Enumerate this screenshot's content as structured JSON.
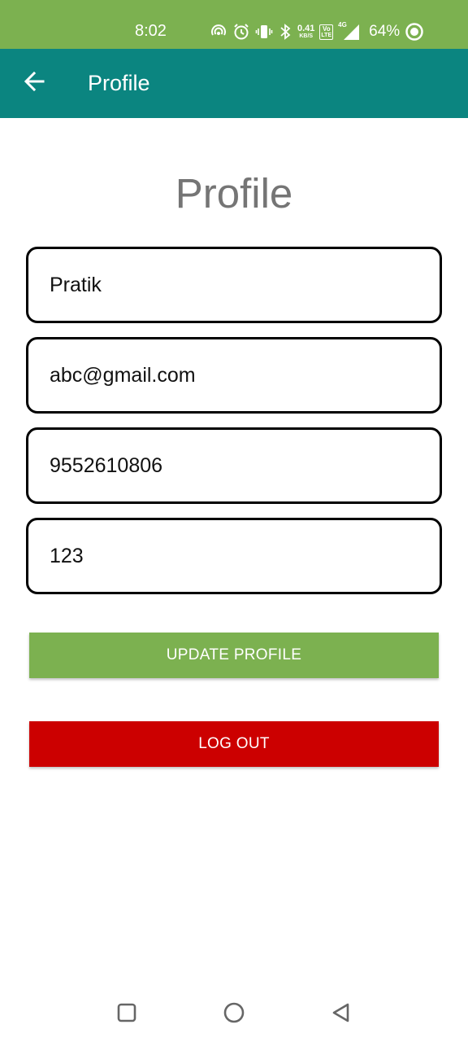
{
  "status_bar": {
    "time": "8:02",
    "speed_value": "0.41",
    "speed_unit": "KB/S",
    "volte_top": "Vo",
    "volte_bottom": "LTE",
    "network": "4G",
    "battery": "64%",
    "icons": [
      "hotspot-icon",
      "alarm-icon",
      "vibrate-icon",
      "bluetooth-icon",
      "signal-icon",
      "battery-icon"
    ]
  },
  "app_bar": {
    "title": "Profile",
    "back_icon": "arrow-left-icon"
  },
  "form": {
    "heading": "Profile",
    "name": "Pratik",
    "email": "abc@gmail.com",
    "phone": "9552610806",
    "password": "123"
  },
  "buttons": {
    "update_label": "UPDATE PROFILE",
    "logout_label": "LOG OUT"
  },
  "colors": {
    "status_bar": "#7cb150",
    "app_bar": "#0b8580",
    "update_button": "#7cb150",
    "logout_button": "#cc0000",
    "heading_text": "#757575"
  },
  "nav": {
    "icons": [
      "square-icon",
      "circle-icon",
      "triangle-back-icon"
    ]
  }
}
